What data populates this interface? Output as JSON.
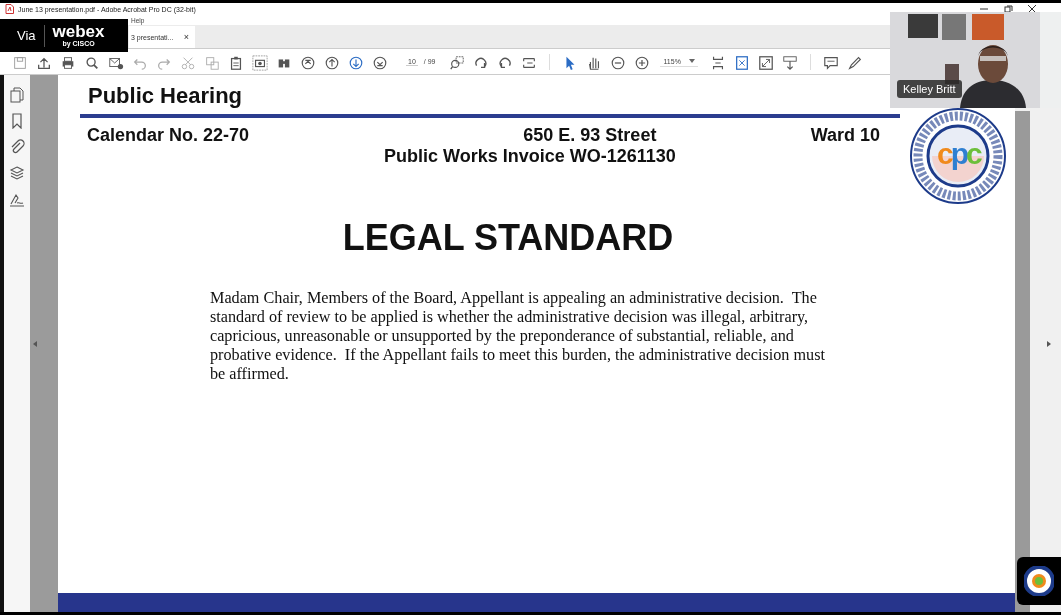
{
  "window": {
    "title": "June 13 presentation.pdf - Adobe Acrobat Pro DC (32-bit)"
  },
  "menu": [
    "Help"
  ],
  "tabs": [
    {
      "label": "3 presentati...",
      "selected": true,
      "close": "×"
    }
  ],
  "toolbar": {
    "page_number": "10",
    "page_count": "/ 99",
    "zoom": "115%"
  },
  "document": {
    "heading": "Public Hearing",
    "calendar": "Calendar No. 22-70",
    "address": "650 E. 93 Street",
    "ward": "Ward 10",
    "invoice": "Public Works Invoice WO-1261130",
    "logo": "cpc",
    "title": "LEGAL STANDARD",
    "body": "Madam Chair, Members of the Board, Appellant is appealing an administrative decision.  The standard of review to be applied is whether the administrative decision was illegal, arbitrary, capricious, unreasonable or unsupported by the preponderance of substantial, reliable, and probative evidence.  If the Appellant fails to meet this burden, the administrative decision must be affirmed."
  },
  "overlay": {
    "via": "Via",
    "brand": "webex",
    "by": "by CISCO"
  },
  "participant": {
    "name": "Kelley Britt"
  }
}
